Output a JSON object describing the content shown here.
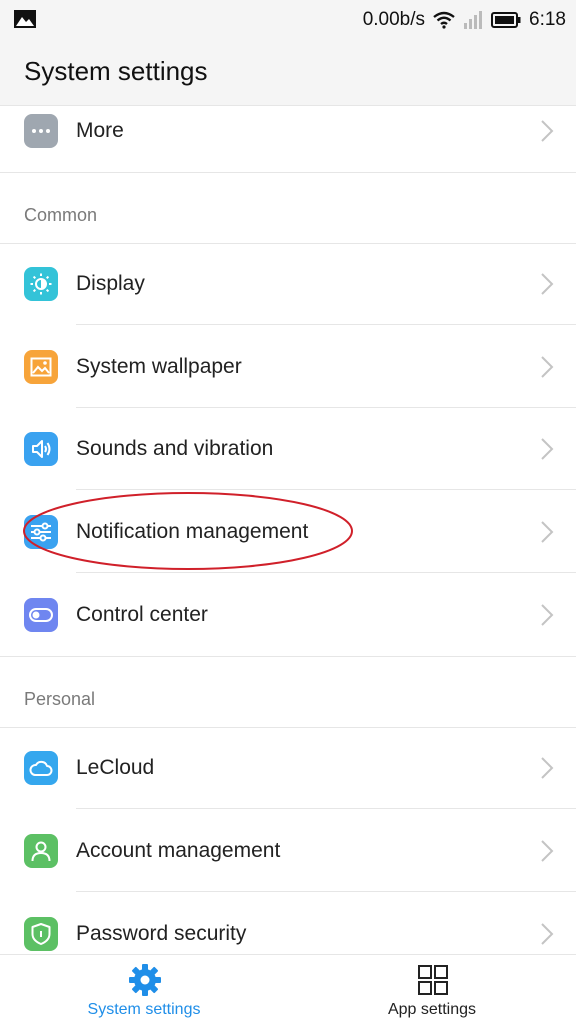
{
  "status_bar": {
    "network_speed": "0.00b/s",
    "time": "6:18",
    "icons": [
      "image-icon",
      "wifi-icon",
      "signal-icon",
      "battery-icon"
    ]
  },
  "header": {
    "title": "System settings"
  },
  "sections": {
    "common": "Common",
    "personal": "Personal"
  },
  "items": {
    "more": {
      "label": "More",
      "icon": "more-icon",
      "color": "#9fa7b0"
    },
    "display": {
      "label": "Display",
      "icon": "brightness-icon",
      "color": "#33c3d8"
    },
    "wallpaper": {
      "label": "System wallpaper",
      "icon": "image-icon",
      "color": "#f7a43a"
    },
    "sounds": {
      "label": "Sounds and vibration",
      "icon": "speaker-icon",
      "color": "#3aa2f0"
    },
    "notification": {
      "label": "Notification management",
      "icon": "sliders-icon",
      "color": "#3aa2f0"
    },
    "control": {
      "label": "Control center",
      "icon": "toggle-icon",
      "color": "#6f86f0"
    },
    "lecloud": {
      "label": "LeCloud",
      "icon": "cloud-icon",
      "color": "#35a7ee"
    },
    "account": {
      "label": "Account management",
      "icon": "person-icon",
      "color": "#5cc064"
    },
    "password": {
      "label": "Password security",
      "icon": "shield-icon",
      "color": "#5cc064"
    }
  },
  "bottom_nav": {
    "system_settings": {
      "label": "System settings",
      "icon": "gear-icon",
      "active": true,
      "color": "#1f8ee8"
    },
    "app_settings": {
      "label": "App settings",
      "icon": "grid-icon",
      "active": false,
      "color": "#222222"
    }
  },
  "annotation": {
    "color": "#d0202a"
  }
}
